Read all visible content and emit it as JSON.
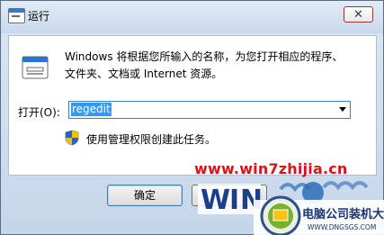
{
  "window": {
    "title": "运行",
    "close_symbol": "✕",
    "title_icon": "run-program-icon"
  },
  "content": {
    "description_line1": "Windows 将根据您所输入的名称，为您打开相应的程序、",
    "description_line2": "文件夹、文档或 Internet 资源。",
    "open_label": "打开(O):",
    "combo_value": "regedit",
    "admin_note": "使用管理权限创建此任务。"
  },
  "buttons": {
    "ok": "确定"
  },
  "watermark": {
    "site": "www.win7zhijia.cn",
    "logo_text": "电脑公司装机大师",
    "logo_url": "WWW.DNGSGS.COM"
  },
  "colors": {
    "selection": "#3399ff",
    "watermark_red": "#d9141a"
  }
}
